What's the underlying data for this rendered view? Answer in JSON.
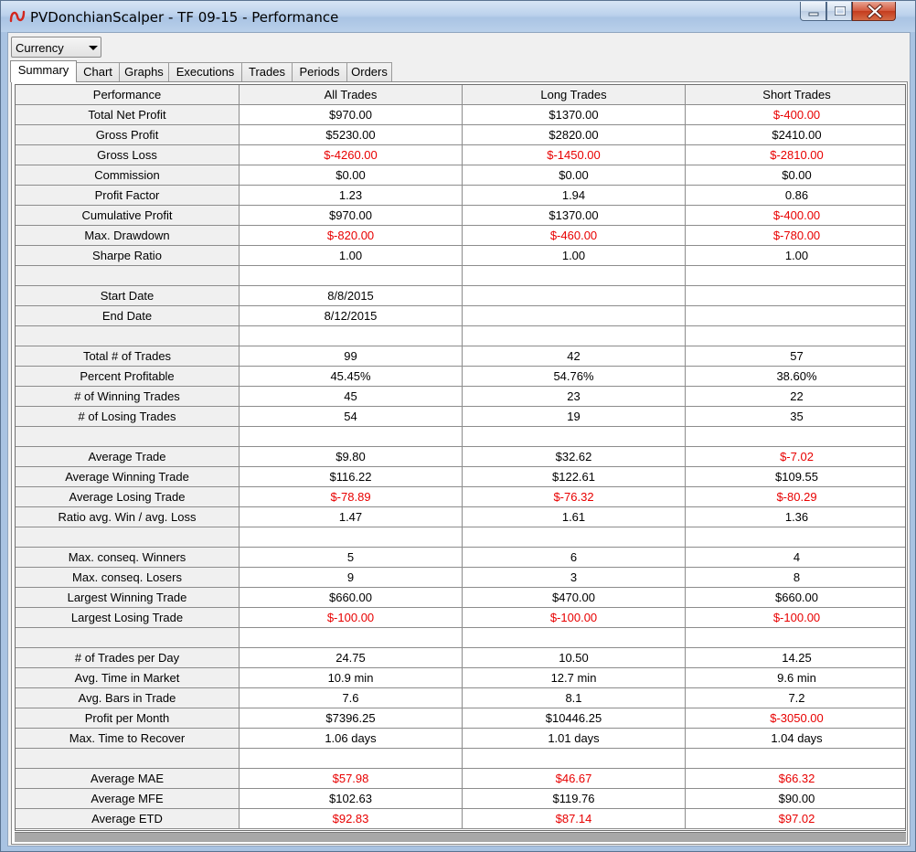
{
  "window": {
    "title": "PVDonchianScalper - TF 09-15 - Performance",
    "buttons": {
      "minimize": "minimize",
      "maximize": "maximize",
      "close": "close"
    }
  },
  "currency_select": {
    "value": "Currency"
  },
  "tabs": [
    {
      "label": "Summary",
      "active": true
    },
    {
      "label": "Chart",
      "active": false
    },
    {
      "label": "Graphs",
      "active": false
    },
    {
      "label": "Executions",
      "active": false
    },
    {
      "label": "Trades",
      "active": false
    },
    {
      "label": "Periods",
      "active": false
    },
    {
      "label": "Orders",
      "active": false
    }
  ],
  "colors": {
    "negative": "#e80000",
    "label_bg": "#f0f0f0"
  },
  "table": {
    "columns": [
      "Performance",
      "All Trades",
      "Long Trades",
      "Short Trades"
    ],
    "rows": [
      [
        "Total Net Profit",
        "$970.00",
        "$1370.00",
        "$-400.00"
      ],
      [
        "Gross Profit",
        "$5230.00",
        "$2820.00",
        "$2410.00"
      ],
      [
        "Gross Loss",
        "$-4260.00",
        "$-1450.00",
        "$-2810.00"
      ],
      [
        "Commission",
        "$0.00",
        "$0.00",
        "$0.00"
      ],
      [
        "Profit Factor",
        "1.23",
        "1.94",
        "0.86"
      ],
      [
        "Cumulative Profit",
        "$970.00",
        "$1370.00",
        "$-400.00"
      ],
      [
        "Max. Drawdown",
        "$-820.00",
        "$-460.00",
        "$-780.00"
      ],
      [
        "Sharpe Ratio",
        "1.00",
        "1.00",
        "1.00"
      ],
      [
        "",
        "",
        "",
        ""
      ],
      [
        "Start Date",
        "8/8/2015",
        "",
        ""
      ],
      [
        "End Date",
        "8/12/2015",
        "",
        ""
      ],
      [
        "",
        "",
        "",
        ""
      ],
      [
        "Total # of Trades",
        "99",
        "42",
        "57"
      ],
      [
        "Percent Profitable",
        "45.45%",
        "54.76%",
        "38.60%"
      ],
      [
        "# of Winning Trades",
        "45",
        "23",
        "22"
      ],
      [
        "# of Losing Trades",
        "54",
        "19",
        "35"
      ],
      [
        "",
        "",
        "",
        ""
      ],
      [
        "Average Trade",
        "$9.80",
        "$32.62",
        "$-7.02"
      ],
      [
        "Average Winning Trade",
        "$116.22",
        "$122.61",
        "$109.55"
      ],
      [
        "Average Losing Trade",
        "$-78.89",
        "$-76.32",
        "$-80.29"
      ],
      [
        "Ratio avg. Win / avg. Loss",
        "1.47",
        "1.61",
        "1.36"
      ],
      [
        "",
        "",
        "",
        ""
      ],
      [
        "Max. conseq. Winners",
        "5",
        "6",
        "4"
      ],
      [
        "Max. conseq. Losers",
        "9",
        "3",
        "8"
      ],
      [
        "Largest Winning Trade",
        "$660.00",
        "$470.00",
        "$660.00"
      ],
      [
        "Largest Losing Trade",
        "$-100.00",
        "$-100.00",
        "$-100.00"
      ],
      [
        "",
        "",
        "",
        ""
      ],
      [
        "# of Trades per Day",
        "24.75",
        "10.50",
        "14.25"
      ],
      [
        "Avg. Time in Market",
        "10.9 min",
        "12.7 min",
        "9.6 min"
      ],
      [
        "Avg. Bars in Trade",
        "7.6",
        "8.1",
        "7.2"
      ],
      [
        "Profit per Month",
        "$7396.25",
        "$10446.25",
        "$-3050.00"
      ],
      [
        "Max. Time to Recover",
        "1.06 days",
        "1.01 days",
        "1.04 days"
      ],
      [
        "",
        "",
        "",
        ""
      ],
      [
        "Average MAE",
        "$57.98",
        "$46.67",
        "$66.32"
      ],
      [
        "Average MFE",
        "$102.63",
        "$119.76",
        "$90.00"
      ],
      [
        "Average ETD",
        "$92.83",
        "$87.14",
        "$97.02"
      ]
    ],
    "red_cells": [
      [
        0,
        3
      ],
      [
        2,
        1
      ],
      [
        2,
        2
      ],
      [
        2,
        3
      ],
      [
        5,
        3
      ],
      [
        6,
        1
      ],
      [
        6,
        2
      ],
      [
        6,
        3
      ],
      [
        17,
        3
      ],
      [
        19,
        1
      ],
      [
        19,
        2
      ],
      [
        19,
        3
      ],
      [
        25,
        1
      ],
      [
        25,
        2
      ],
      [
        25,
        3
      ],
      [
        30,
        3
      ],
      [
        33,
        1
      ],
      [
        33,
        2
      ],
      [
        33,
        3
      ],
      [
        35,
        1
      ],
      [
        35,
        2
      ],
      [
        35,
        3
      ]
    ]
  }
}
